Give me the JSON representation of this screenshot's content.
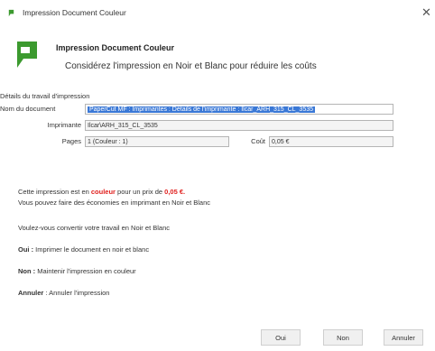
{
  "window": {
    "title": "Impression Document Couleur",
    "close_glyph": "✕"
  },
  "header": {
    "heading": "Impression Document Couleur",
    "subheading": "Considérez l'impression en Noir et Blanc pour réduire les coûts",
    "logo_icon": "papercut-logo-icon",
    "accent": "#3c9a2f"
  },
  "details": {
    "section_label": "Détails du travail d'impression",
    "document_label": "Nom du document",
    "document_value": "PaperCut MF : Imprimantes : Détails de l'imprimante : Ilcar_ARH_315_CL_3535",
    "printer_label": "Imprimante",
    "printer_value": "Ilcar\\ARH_315_CL_3535",
    "pages_label": "Pages",
    "pages_value": "1  (Couleur : 1)",
    "cost_label": "Coût",
    "cost_value": "0,05 €"
  },
  "message": {
    "line1_pre": "Cette impression est en ",
    "line1_color": "couleur",
    "line1_mid": " pour un prix de ",
    "line1_price": "0,05 €.",
    "line2": "Vous pouvez faire des économies en imprimant en Noir et Blanc",
    "question": "Voulez-vous convertir votre travail en Noir et Blanc",
    "oui_label": "Oui :",
    "oui_text": " Imprimer le document en noir et blanc",
    "non_label": "Non :",
    "non_text": " Maintenir l'impression en couleur",
    "annuler_label": "Annuler",
    "annuler_text": " : Annuler l'impression"
  },
  "buttons": {
    "oui": "Oui",
    "non": "Non",
    "annuler": "Annuler"
  },
  "colors": {
    "selection": "#3a78d6",
    "highlight_red": "#e0201e"
  }
}
